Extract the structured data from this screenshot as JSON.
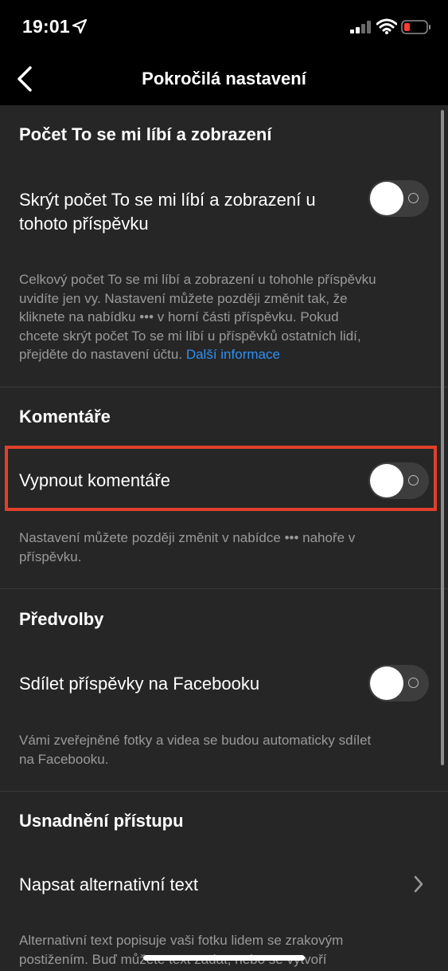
{
  "status_bar": {
    "time": "19:01"
  },
  "nav": {
    "title": "Pokročilá nastavení"
  },
  "sections": [
    {
      "title": "Počet To se mi líbí a zobrazení",
      "row_label_line1": "Skrýt počet To se mi líbí a zobrazení u",
      "row_label_line2": "tohoto příspěvku",
      "toggle_on": false,
      "desc_line1": "Celkový počet To se mi líbí a zobrazení u tohohle příspěvku",
      "desc_line2": "uvidíte jen vy. Nastavení můžete později změnit tak, že",
      "desc_line3": "kliknete na nabídku ••• v horní části příspěvku. Pokud",
      "desc_line4": "chcete skrýt počet To se mi líbí u příspěvků ostatních lidí,",
      "desc_line5": "přejděte do nastavení účtu.",
      "link": "Další informace"
    },
    {
      "title": "Komentáře",
      "row_label": "Vypnout komentáře",
      "toggle_on": false,
      "desc_line1": "Nastavení můžete později změnit v nabídce ••• nahoře v",
      "desc_line2": "příspěvku."
    },
    {
      "title": "Předvolby",
      "row_label": "Sdílet příspěvky na Facebooku",
      "toggle_on": false,
      "desc_line1": "Vámi zveřejněné fotky a videa se budou automaticky sdílet",
      "desc_line2": "na Facebooku."
    },
    {
      "title": "Usnadnění přístupu",
      "row_label": "Napsat alternativní text",
      "desc_line1": "Alternativní text popisuje vaši fotku lidem se zrakovým",
      "desc_line2": "postižením. Buď můžete text zadat, nebo se vytvoří"
    }
  ],
  "colors": {
    "background": "#262626",
    "header": "#000000",
    "link": "#2f8ff5",
    "highlight": "#e0402a",
    "description": "#9a9a9a"
  },
  "icons": [
    "location-arrow-icon",
    "signal-icon",
    "wifi-icon",
    "battery-low-icon",
    "back-chevron-icon",
    "chevron-right-icon"
  ]
}
